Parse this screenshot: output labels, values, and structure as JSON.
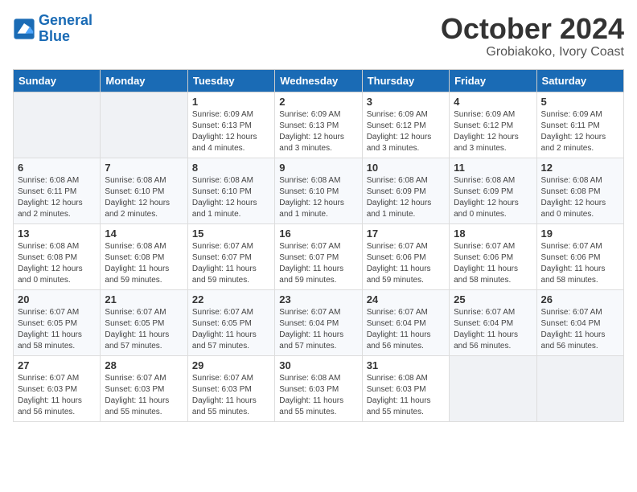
{
  "logo": {
    "line1": "General",
    "line2": "Blue"
  },
  "title": "October 2024",
  "subtitle": "Grobiakoko, Ivory Coast",
  "days_of_week": [
    "Sunday",
    "Monday",
    "Tuesday",
    "Wednesday",
    "Thursday",
    "Friday",
    "Saturday"
  ],
  "weeks": [
    [
      {
        "num": "",
        "info": ""
      },
      {
        "num": "",
        "info": ""
      },
      {
        "num": "1",
        "info": "Sunrise: 6:09 AM\nSunset: 6:13 PM\nDaylight: 12 hours and 4 minutes."
      },
      {
        "num": "2",
        "info": "Sunrise: 6:09 AM\nSunset: 6:13 PM\nDaylight: 12 hours and 3 minutes."
      },
      {
        "num": "3",
        "info": "Sunrise: 6:09 AM\nSunset: 6:12 PM\nDaylight: 12 hours and 3 minutes."
      },
      {
        "num": "4",
        "info": "Sunrise: 6:09 AM\nSunset: 6:12 PM\nDaylight: 12 hours and 3 minutes."
      },
      {
        "num": "5",
        "info": "Sunrise: 6:09 AM\nSunset: 6:11 PM\nDaylight: 12 hours and 2 minutes."
      }
    ],
    [
      {
        "num": "6",
        "info": "Sunrise: 6:08 AM\nSunset: 6:11 PM\nDaylight: 12 hours and 2 minutes."
      },
      {
        "num": "7",
        "info": "Sunrise: 6:08 AM\nSunset: 6:10 PM\nDaylight: 12 hours and 2 minutes."
      },
      {
        "num": "8",
        "info": "Sunrise: 6:08 AM\nSunset: 6:10 PM\nDaylight: 12 hours and 1 minute."
      },
      {
        "num": "9",
        "info": "Sunrise: 6:08 AM\nSunset: 6:10 PM\nDaylight: 12 hours and 1 minute."
      },
      {
        "num": "10",
        "info": "Sunrise: 6:08 AM\nSunset: 6:09 PM\nDaylight: 12 hours and 1 minute."
      },
      {
        "num": "11",
        "info": "Sunrise: 6:08 AM\nSunset: 6:09 PM\nDaylight: 12 hours and 0 minutes."
      },
      {
        "num": "12",
        "info": "Sunrise: 6:08 AM\nSunset: 6:08 PM\nDaylight: 12 hours and 0 minutes."
      }
    ],
    [
      {
        "num": "13",
        "info": "Sunrise: 6:08 AM\nSunset: 6:08 PM\nDaylight: 12 hours and 0 minutes."
      },
      {
        "num": "14",
        "info": "Sunrise: 6:08 AM\nSunset: 6:08 PM\nDaylight: 11 hours and 59 minutes."
      },
      {
        "num": "15",
        "info": "Sunrise: 6:07 AM\nSunset: 6:07 PM\nDaylight: 11 hours and 59 minutes."
      },
      {
        "num": "16",
        "info": "Sunrise: 6:07 AM\nSunset: 6:07 PM\nDaylight: 11 hours and 59 minutes."
      },
      {
        "num": "17",
        "info": "Sunrise: 6:07 AM\nSunset: 6:06 PM\nDaylight: 11 hours and 59 minutes."
      },
      {
        "num": "18",
        "info": "Sunrise: 6:07 AM\nSunset: 6:06 PM\nDaylight: 11 hours and 58 minutes."
      },
      {
        "num": "19",
        "info": "Sunrise: 6:07 AM\nSunset: 6:06 PM\nDaylight: 11 hours and 58 minutes."
      }
    ],
    [
      {
        "num": "20",
        "info": "Sunrise: 6:07 AM\nSunset: 6:05 PM\nDaylight: 11 hours and 58 minutes."
      },
      {
        "num": "21",
        "info": "Sunrise: 6:07 AM\nSunset: 6:05 PM\nDaylight: 11 hours and 57 minutes."
      },
      {
        "num": "22",
        "info": "Sunrise: 6:07 AM\nSunset: 6:05 PM\nDaylight: 11 hours and 57 minutes."
      },
      {
        "num": "23",
        "info": "Sunrise: 6:07 AM\nSunset: 6:04 PM\nDaylight: 11 hours and 57 minutes."
      },
      {
        "num": "24",
        "info": "Sunrise: 6:07 AM\nSunset: 6:04 PM\nDaylight: 11 hours and 56 minutes."
      },
      {
        "num": "25",
        "info": "Sunrise: 6:07 AM\nSunset: 6:04 PM\nDaylight: 11 hours and 56 minutes."
      },
      {
        "num": "26",
        "info": "Sunrise: 6:07 AM\nSunset: 6:04 PM\nDaylight: 11 hours and 56 minutes."
      }
    ],
    [
      {
        "num": "27",
        "info": "Sunrise: 6:07 AM\nSunset: 6:03 PM\nDaylight: 11 hours and 56 minutes."
      },
      {
        "num": "28",
        "info": "Sunrise: 6:07 AM\nSunset: 6:03 PM\nDaylight: 11 hours and 55 minutes."
      },
      {
        "num": "29",
        "info": "Sunrise: 6:07 AM\nSunset: 6:03 PM\nDaylight: 11 hours and 55 minutes."
      },
      {
        "num": "30",
        "info": "Sunrise: 6:08 AM\nSunset: 6:03 PM\nDaylight: 11 hours and 55 minutes."
      },
      {
        "num": "31",
        "info": "Sunrise: 6:08 AM\nSunset: 6:03 PM\nDaylight: 11 hours and 55 minutes."
      },
      {
        "num": "",
        "info": ""
      },
      {
        "num": "",
        "info": ""
      }
    ]
  ]
}
